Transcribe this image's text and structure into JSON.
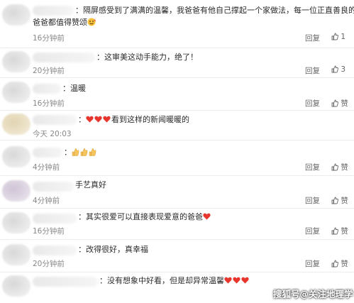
{
  "comments": [
    {
      "text_line1": "：隔屏感受到了满满的温馨，我爸爸有他自己撑起一个家做法，每一位正直善良的",
      "text_line2": "爸爸都值得赞颂",
      "time": "16分钟前",
      "reply": "回复",
      "likes": "1"
    },
    {
      "text": "：这审美这动手能力，绝了！",
      "time": "20分钟前",
      "reply": "回复",
      "likes": "3"
    },
    {
      "text": "：温暖",
      "time": "16分钟前",
      "reply": "回复",
      "likes": "赞"
    },
    {
      "prefix": "：",
      "text": "看到这样的新闻暖暖的",
      "time": "今天 20:03",
      "reply": "",
      "likes": ""
    },
    {
      "prefix": "：",
      "text": "",
      "time": "4分钟前",
      "reply": "回复",
      "likes": "赞"
    },
    {
      "text": "手艺真好",
      "time": "4分钟前",
      "reply": "回复",
      "likes": "赞"
    },
    {
      "text": "：其实很爱可以直接表现爱意的爸爸",
      "time": "16分钟前",
      "reply": "回复",
      "likes": "赞"
    },
    {
      "text": "：改得很好，真幸福",
      "time": "20分钟前",
      "reply": "回复",
      "likes": "赞"
    },
    {
      "text": "：没有想象中好看，但是却异常温馨",
      "time": "",
      "reply": "",
      "likes": ""
    }
  ],
  "watermark": "搜狐号@关注地理学",
  "colors": {
    "heart": "#e8362e",
    "time": "#888888",
    "action": "#666666"
  }
}
